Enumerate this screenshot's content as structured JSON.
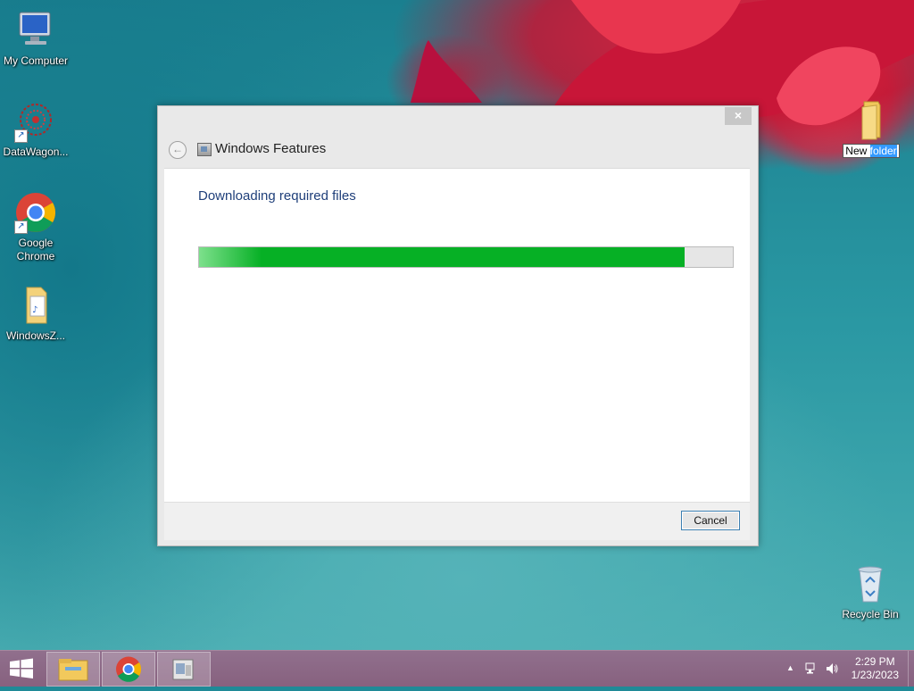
{
  "desktop": {
    "icons": [
      {
        "label": "My Computer"
      },
      {
        "label": "DataWagon..."
      },
      {
        "label": "Google Chrome"
      },
      {
        "label": "WindowsZ..."
      },
      {
        "label": "Recycle Bin"
      }
    ],
    "new_folder": {
      "label_prefix": "New",
      "label_selected": "folder"
    }
  },
  "dialog": {
    "title": "Windows Features",
    "close_symbol": "×",
    "status": "Downloading required files",
    "progress": 0.91,
    "cancel_label": "Cancel"
  },
  "taskbar": {
    "tray_overflow": "▲",
    "time": "2:29 PM",
    "date": "1/23/2023"
  },
  "colors": {
    "progress": "#06b025",
    "accent": "#3c7fb1"
  }
}
